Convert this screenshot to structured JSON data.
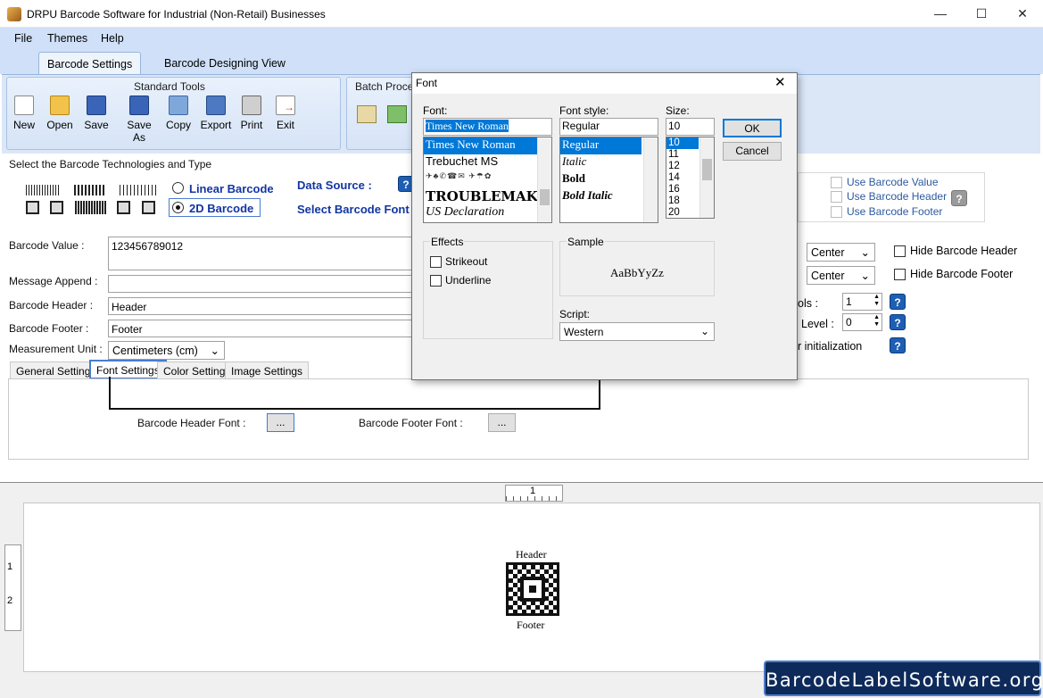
{
  "window": {
    "title": "DRPU Barcode Software for Industrial (Non-Retail) Businesses",
    "minimize": "—",
    "maximize": "☐",
    "close": "✕"
  },
  "menu": [
    "File",
    "Themes",
    "Help"
  ],
  "tabs": [
    "Barcode Settings",
    "Barcode Designing View"
  ],
  "ribbon": {
    "standard_title": "Standard Tools",
    "batch_title": "Batch Proces",
    "tools": [
      {
        "label": "New",
        "icon": "new-icon"
      },
      {
        "label": "Open",
        "icon": "open-icon"
      },
      {
        "label": "Save",
        "icon": "save-icon"
      },
      {
        "label": "Save As",
        "icon": "save-as-icon"
      },
      {
        "label": "Copy",
        "icon": "copy-icon"
      },
      {
        "label": "Export",
        "icon": "export-icon"
      },
      {
        "label": "Print",
        "icon": "print-icon"
      },
      {
        "label": "Exit",
        "icon": "exit-icon"
      }
    ]
  },
  "main": {
    "select_tech": "Select the Barcode Technologies and Type",
    "linear": "Linear Barcode",
    "twod": "2D Barcode",
    "selected_type": "2D Barcode",
    "data_source": "Data Source :",
    "select_font": "Select Barcode Font",
    "barcode_value_label": "Barcode Value :",
    "barcode_value": "123456789012",
    "message_append_label": "Message Append :",
    "message_append": "",
    "header_label": "Barcode Header :",
    "header_value": "Header",
    "footer_label": "Barcode Footer :",
    "footer_value": "Footer",
    "measure_label": "Measurement Unit :",
    "measure_value": "Centimeters (cm)",
    "use_value": "Use Barcode Value",
    "use_header": "Use Barcode Header",
    "use_footer": "Use Barcode Footer",
    "align_header": "Center",
    "align_footer": "Center",
    "hide_header": "Hide Barcode Header",
    "hide_footer": "Hide Barcode Footer",
    "cols_label": "ols :",
    "cols_value": "1",
    "level_label": "Level :",
    "level_value": "0",
    "init_label": "r initialization",
    "help": "?"
  },
  "subtabs": [
    "General Settings",
    "Font Settings",
    "Color Settings",
    "Image Settings"
  ],
  "font_settings": {
    "header_font_label": "Barcode Header Font :",
    "footer_font_label": "Barcode Footer Font :",
    "browse": "..."
  },
  "designer": {
    "ruler_top": "1",
    "ruler_left": [
      "1",
      "2"
    ],
    "header": "Header",
    "footer": "Footer"
  },
  "dialog": {
    "title": "Font",
    "font_label": "Font:",
    "font_value": "Times New Roman",
    "fonts": [
      "Times New Roman",
      "Trebuchet MS",
      "Webdings",
      "TROUBLEMAKER",
      "US Declaration"
    ],
    "style_label": "Font style:",
    "style_value": "Regular",
    "styles": [
      "Regular",
      "Italic",
      "Bold",
      "Bold Italic"
    ],
    "size_label": "Size:",
    "size_value": "10",
    "sizes": [
      "10",
      "11",
      "12",
      "14",
      "16",
      "18",
      "20"
    ],
    "ok": "OK",
    "cancel": "Cancel",
    "effects_label": "Effects",
    "strikeout": "Strikeout",
    "underline": "Underline",
    "sample_label": "Sample",
    "sample_text": "AaBbYyZz",
    "script_label": "Script:",
    "script_value": "Western"
  },
  "watermark": "BarcodeLabelSoftware.org"
}
